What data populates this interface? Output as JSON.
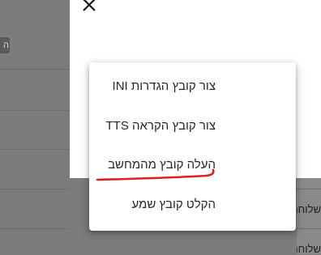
{
  "background": {
    "chip_text": "ה",
    "row_labels": [
      "שלוחה",
      "שלוחה"
    ]
  },
  "modal": {
    "close_icon": "close-icon"
  },
  "menu": {
    "items": [
      {
        "label": "צור קובץ הגדרות INI"
      },
      {
        "label": "צור קובץ הקראה TTS"
      },
      {
        "label": "העלה קובץ מהמחשב"
      },
      {
        "label": "הקלט קובץ שמע"
      }
    ]
  },
  "colors": {
    "overlay": "#7c7c7c",
    "menu_bg": "#ffffff",
    "annotation": "#e02020"
  }
}
